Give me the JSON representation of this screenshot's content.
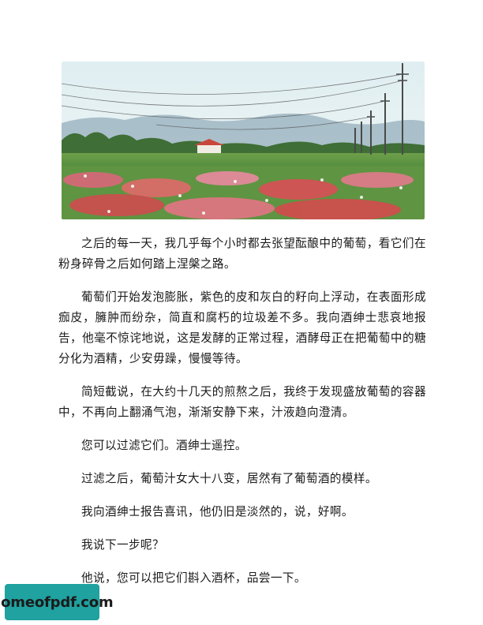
{
  "paragraphs": [
    "之后的每一天，我几乎每个小时都去张望酝酿中的葡萄，看它们在粉身碎骨之后如何踏上涅槃之路。",
    "葡萄们开始发泡膨胀，紫色的皮和灰白的籽向上浮动，在表面形成痂皮，臃肿而纷杂，简直和腐朽的垃圾差不多。我向酒绅士悲哀地报告，他毫不惊诧地说，这是发酵的正常过程，酒酵母正在把葡萄中的糖分化为酒精，少安毋躁，慢慢等待。",
    "简短截说，在大约十几天的煎熬之后，我终于发现盛放葡萄的容器中，不再向上翻涌气泡，渐渐安静下来，汁液趋向澄清。",
    "您可以过滤它们。酒绅士遥控。",
    "过滤之后，葡萄汁女大十八变，居然有了葡萄酒的模样。",
    "我向酒绅士报告喜讯，他仍旧是淡然的，说，好啊。",
    "我说下一步呢？",
    "他说，您可以把它们斟入酒杯，品尝一下。"
  ],
  "watermark": {
    "text": "homeofpdf.com",
    "background": "#1fa2a0"
  },
  "illustration": {
    "icon": "watercolor-flower-field-image"
  }
}
